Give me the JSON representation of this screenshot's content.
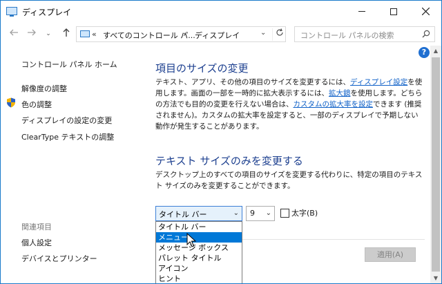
{
  "window": {
    "title": "ディスプレイ"
  },
  "nav": {
    "recent_glyph": "⌄",
    "address": {
      "overflow": "«",
      "crumb1": "すべてのコントロール パ...",
      "arrow": "›",
      "crumb2": "ディスプレイ"
    },
    "search_placeholder": "コントロール パネルの検索"
  },
  "sidebar": {
    "home": "コントロール パネル ホーム",
    "resolution": "解像度の調整",
    "color": "色の調整",
    "advanced": "ディスプレイの設定の変更",
    "cleartype": "ClearType テキストの調整",
    "related_heading": "関連項目",
    "personalization": "個人設定",
    "devices": "デバイスとプリンター"
  },
  "help": "?",
  "section1": {
    "heading": "項目のサイズの変更",
    "text_a": "テキスト、アプリ、その他の項目のサイズを変更するには、",
    "link_display": "ディスプレイ設定",
    "text_b": "を使用します。画面の一部を一時的に拡大表示するには、",
    "link_magnifier": "拡大鏡",
    "text_c": "を使用します。どちらの方法でも目的の変更を行えない場合は、",
    "link_custom": "カスタムの拡大率を設定",
    "text_d": "できます (推奨されません)。カスタムの拡大率を設定すると、一部のディスプレイで予期しない動作が発生することがあります。"
  },
  "section2": {
    "heading": "テキスト サイズのみを変更する",
    "text": "デスクトップ上のすべての項目のサイズを変更する代わりに、特定の項目のテキスト サイズのみを変更することができます。"
  },
  "controls": {
    "item_selected": "タイトル バー",
    "size_selected": "9",
    "bold_label": "太字(B)",
    "bold_checked": false,
    "apply": "適用(A)"
  },
  "dropdown": {
    "options": [
      "タイトル バー",
      "メニュー",
      "メッセージ ボックス",
      "パレット タイトル",
      "アイコン",
      "ヒント"
    ],
    "highlighted_index": 1
  }
}
